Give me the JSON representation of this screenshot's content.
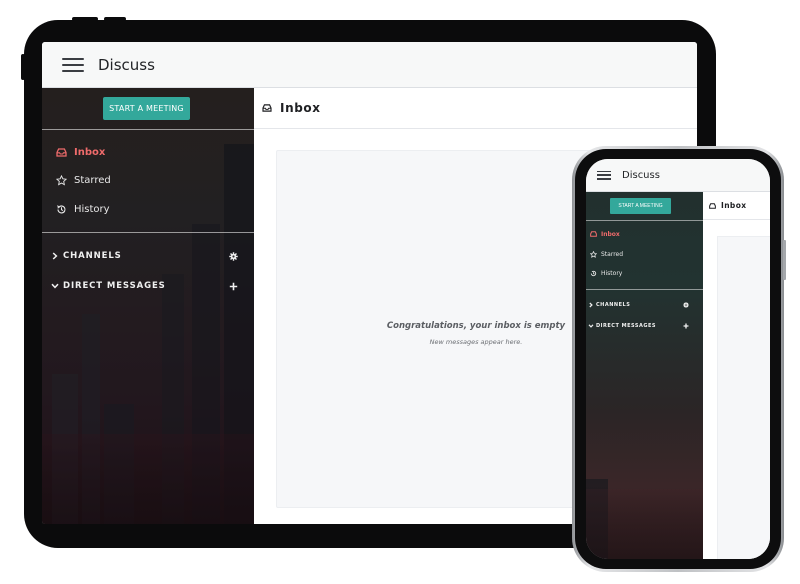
{
  "tablet": {
    "app_title": "Discuss",
    "start_meeting_label": "START A MEETING",
    "nav": [
      {
        "label": "Inbox",
        "icon": "inbox-icon",
        "active": true
      },
      {
        "label": "Starred",
        "icon": "star-icon",
        "active": false
      },
      {
        "label": "History",
        "icon": "history-icon",
        "active": false
      }
    ],
    "sections": [
      {
        "label": "CHANNELS",
        "chevron": "chevron-right-icon",
        "action_icon": "gear-icon"
      },
      {
        "label": "DIRECT MESSAGES",
        "chevron": "chevron-down-icon",
        "action_icon": "plus-icon"
      }
    ],
    "main_title": "Inbox",
    "empty_title": "Congratulations, your inbox is empty",
    "empty_subtitle": "New messages appear here."
  },
  "phone": {
    "app_title": "Discuss",
    "start_meeting_label": "START A MEETING",
    "nav": [
      {
        "label": "Inbox",
        "icon": "inbox-icon",
        "active": true
      },
      {
        "label": "Starred",
        "icon": "star-icon",
        "active": false
      },
      {
        "label": "History",
        "icon": "history-icon",
        "active": false
      }
    ],
    "sections": [
      {
        "label": "CHANNELS",
        "chevron": "chevron-right-icon",
        "action_icon": "gear-icon"
      },
      {
        "label": "DIRECT MESSAGES",
        "chevron": "chevron-down-icon",
        "action_icon": "plus-icon"
      }
    ],
    "main_title": "Inbox"
  },
  "colors": {
    "accent": "#33a89b",
    "active_nav": "#ef6b6b",
    "device_frame": "#0b0b0c",
    "background": "#ffffff"
  }
}
